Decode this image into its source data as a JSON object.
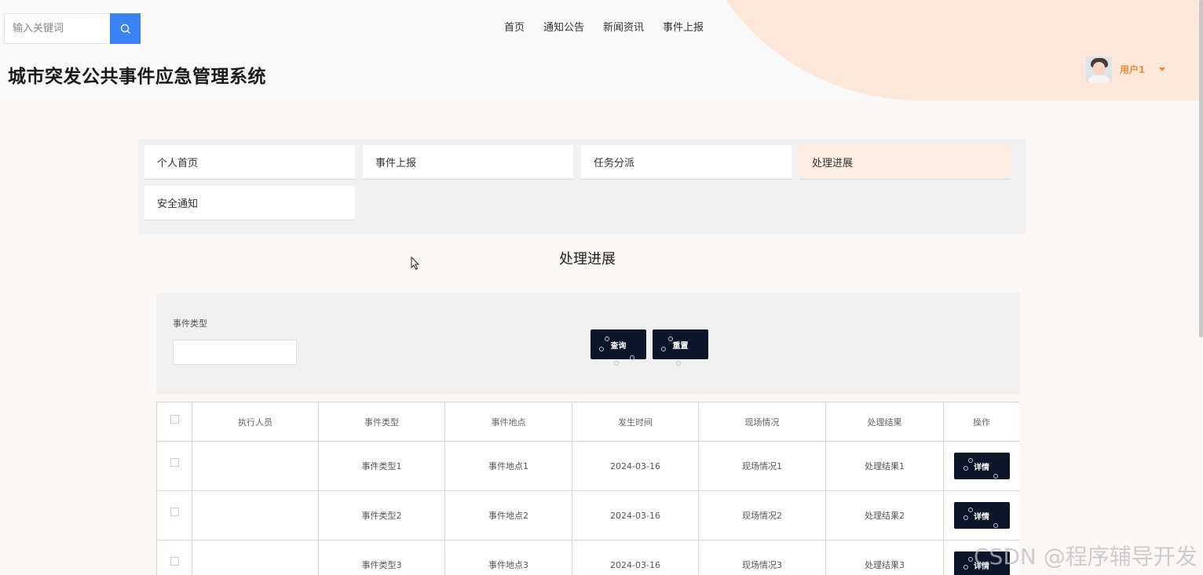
{
  "header": {
    "search": {
      "placeholder": "输入关键词",
      "value": ""
    },
    "nav": [
      "首页",
      "通知公告",
      "新闻资讯",
      "事件上报"
    ],
    "site_title": "城市突发公共事件应急管理系统",
    "user": {
      "name": "用户1"
    }
  },
  "menu": {
    "items": [
      "个人首页",
      "事件上报",
      "任务分派",
      "处理进展",
      "安全通知"
    ],
    "active": "处理进展"
  },
  "page": {
    "heading": "处理进展"
  },
  "filter": {
    "label": "事件类型",
    "input_value": "",
    "query_label": "查询",
    "reset_label": "重置"
  },
  "table": {
    "columns": [
      "执行人员",
      "事件类型",
      "事件地点",
      "发生时间",
      "现场情况",
      "处理结果",
      "操作"
    ],
    "rows": [
      {
        "executor": "",
        "type": "事件类型1",
        "location": "事件地点1",
        "time": "2024-03-16",
        "scene": "现场情况1",
        "result": "处理结果1",
        "action": "详情"
      },
      {
        "executor": "",
        "type": "事件类型2",
        "location": "事件地点2",
        "time": "2024-03-16",
        "scene": "现场情况2",
        "result": "处理结果2",
        "action": "详情"
      },
      {
        "executor": "",
        "type": "事件类型3",
        "location": "事件地点3",
        "time": "2024-03-16",
        "scene": "现场情况3",
        "result": "处理结果3",
        "action": "详情"
      }
    ]
  },
  "watermark": "CSDN @程序辅导开发",
  "colors": {
    "accent_blue": "#3b82f6",
    "dark_button": "#0c1628",
    "user_orange": "#f08a3e",
    "active_menu": "#fdeee4"
  }
}
